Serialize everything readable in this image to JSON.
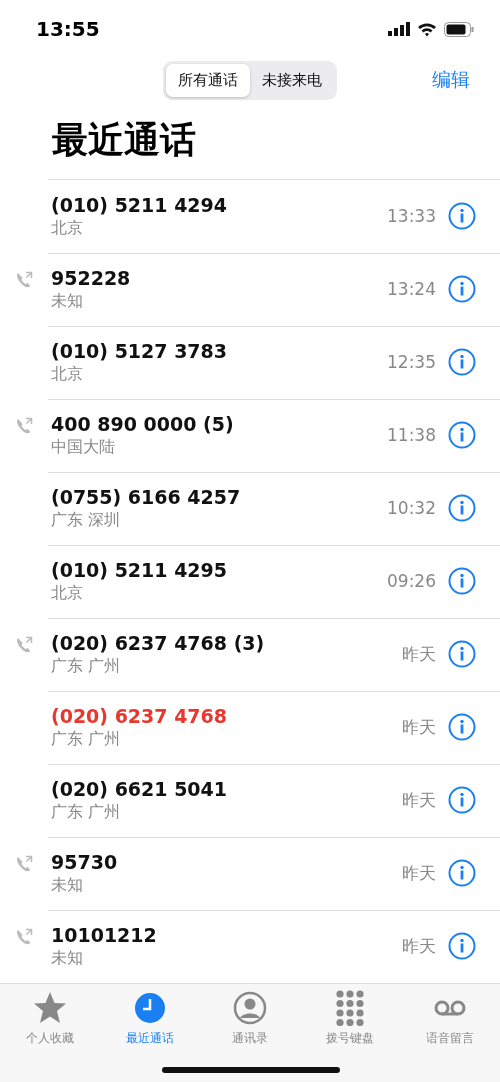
{
  "status_bar": {
    "time": "13:55"
  },
  "segments": [
    {
      "label": "所有通话",
      "selected": true
    },
    {
      "label": "未接来电",
      "selected": false
    }
  ],
  "edit_button": "编辑",
  "title": "最近通话",
  "calls": [
    {
      "number": "(010) 5211 4294",
      "location": "北京",
      "time": "13:33",
      "outgoing": false,
      "missed": false
    },
    {
      "number": "952228",
      "location": "未知",
      "time": "13:24",
      "outgoing": true,
      "missed": false
    },
    {
      "number": "(010) 5127 3783",
      "location": "北京",
      "time": "12:35",
      "outgoing": false,
      "missed": false
    },
    {
      "number": "400 890 0000 (5)",
      "location": "中国大陆",
      "time": "11:38",
      "outgoing": true,
      "missed": false
    },
    {
      "number": "(0755) 6166 4257",
      "location": "广东 深圳",
      "time": "10:32",
      "outgoing": false,
      "missed": false
    },
    {
      "number": "(010) 5211 4295",
      "location": "北京",
      "time": "09:26",
      "outgoing": false,
      "missed": false
    },
    {
      "number": "(020) 6237 4768 (3)",
      "location": "广东 广州",
      "time": "昨天",
      "outgoing": true,
      "missed": false
    },
    {
      "number": "(020) 6237 4768",
      "location": "广东 广州",
      "time": "昨天",
      "outgoing": false,
      "missed": true
    },
    {
      "number": "(020) 6621 5041",
      "location": "广东 广州",
      "time": "昨天",
      "outgoing": false,
      "missed": false
    },
    {
      "number": "95730",
      "location": "未知",
      "time": "昨天",
      "outgoing": true,
      "missed": false
    },
    {
      "number": "10101212",
      "location": "未知",
      "time": "昨天",
      "outgoing": true,
      "missed": false
    }
  ],
  "tab_bar": [
    {
      "kind": "star",
      "label": "个人收藏",
      "selected": false
    },
    {
      "kind": "clock",
      "label": "最近通话",
      "selected": true
    },
    {
      "kind": "person",
      "label": "通讯录",
      "selected": false
    },
    {
      "kind": "keypad",
      "label": "拨号键盘",
      "selected": false
    },
    {
      "kind": "voicemail",
      "label": "语音留言",
      "selected": false
    }
  ]
}
